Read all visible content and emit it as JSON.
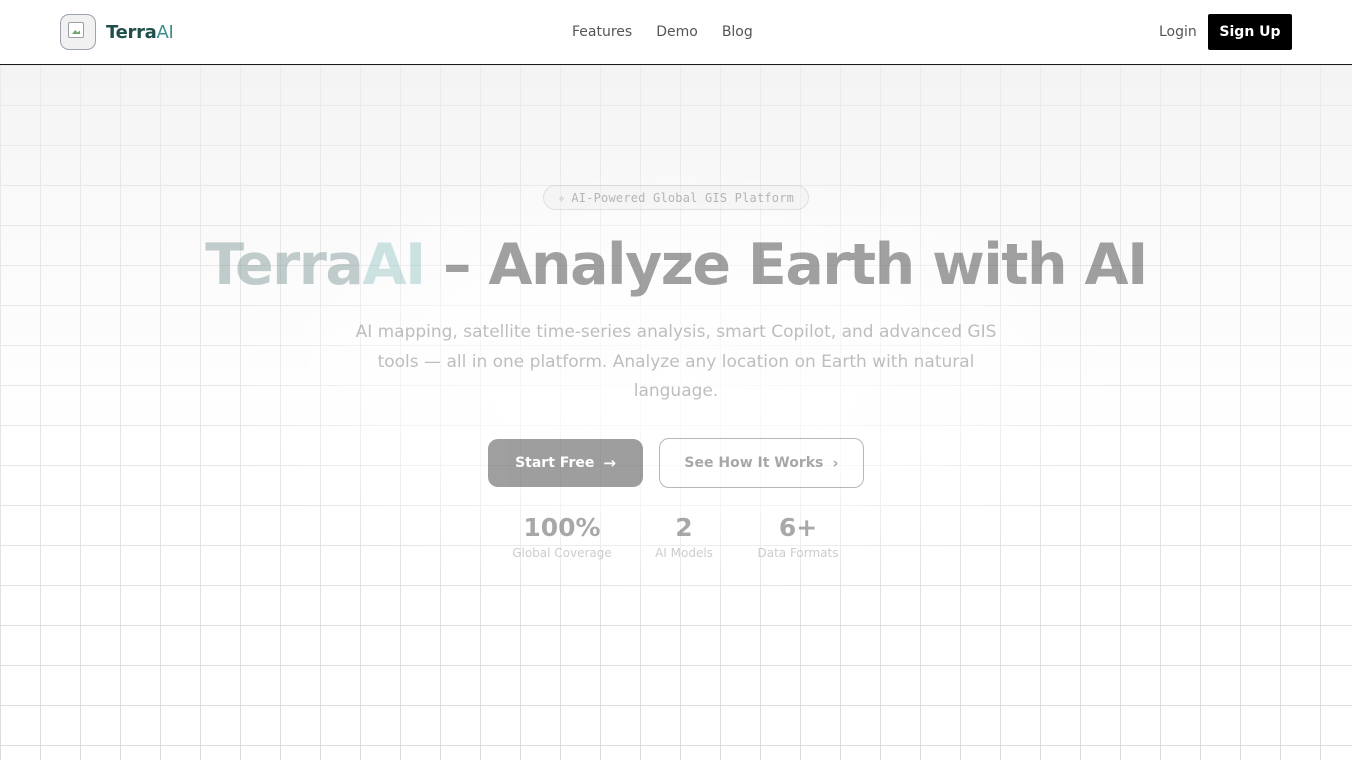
{
  "header": {
    "brand_terra": "Terra",
    "brand_ai": "AI",
    "nav": [
      {
        "label": "Features"
      },
      {
        "label": "Demo"
      },
      {
        "label": "Blog"
      }
    ],
    "login_label": "Login",
    "signup_label": "Sign Up"
  },
  "hero": {
    "badge": "AI-Powered Global GIS Platform",
    "badge_icon": "sparkle-icon",
    "headline_terra": "Terra",
    "headline_ai": "AI",
    "headline_rest": " – Analyze Earth with AI",
    "subtitle": "AI mapping, satellite time-series analysis, smart Copilot, and advanced GIS tools — all in one platform. Analyze any location on Earth with natural language.",
    "primary_cta": "Start Free",
    "primary_cta_icon": "arrow-right-icon",
    "secondary_cta": "See How It Works",
    "secondary_cta_icon": "chevron-right-icon",
    "stats": [
      {
        "value": "100%",
        "label": "Global Coverage"
      },
      {
        "value": "2",
        "label": "AI Models"
      },
      {
        "value": "6+",
        "label": "Data Formats"
      }
    ]
  },
  "colors": {
    "brand_dark": "#1f4f4a",
    "brand_accent": "#3f8e8a",
    "primary_button": "#000000",
    "grid_line": "#dcdcdc"
  }
}
